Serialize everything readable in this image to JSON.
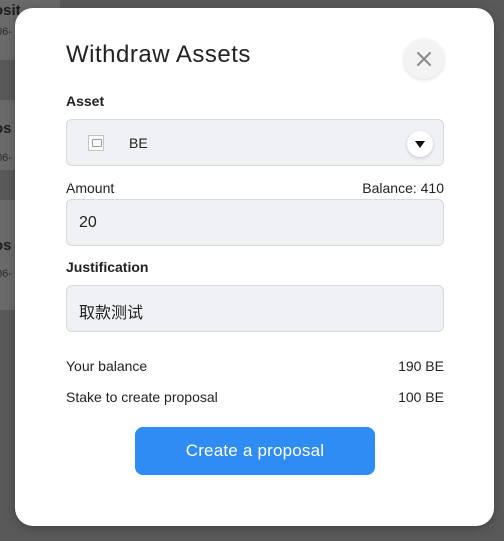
{
  "background": {
    "cards": [
      {
        "title": "osit ",
        "subtitle": "06-"
      },
      {
        "title": "os",
        "subtitle": "06-"
      },
      {
        "title": "os",
        "subtitle": "06-"
      }
    ]
  },
  "modal": {
    "title": "Withdraw Assets",
    "close_icon": "close-icon",
    "asset": {
      "label": "Asset",
      "selected": "BE",
      "icon": "broken-image-icon",
      "caret_icon": "caret-down-icon"
    },
    "amount": {
      "label": "Amount",
      "balance_text": "Balance: 410",
      "value": "20"
    },
    "justification": {
      "label": "Justification",
      "value": "取款测试"
    },
    "summary": {
      "your_balance_label": "Your balance",
      "your_balance_value": "190 BE",
      "stake_label": "Stake to create proposal",
      "stake_value": "100 BE"
    },
    "cta_label": "Create a proposal"
  },
  "colors": {
    "accent": "#2e8cf3",
    "overlay": "#595959",
    "field_bg": "#eff1f5"
  }
}
